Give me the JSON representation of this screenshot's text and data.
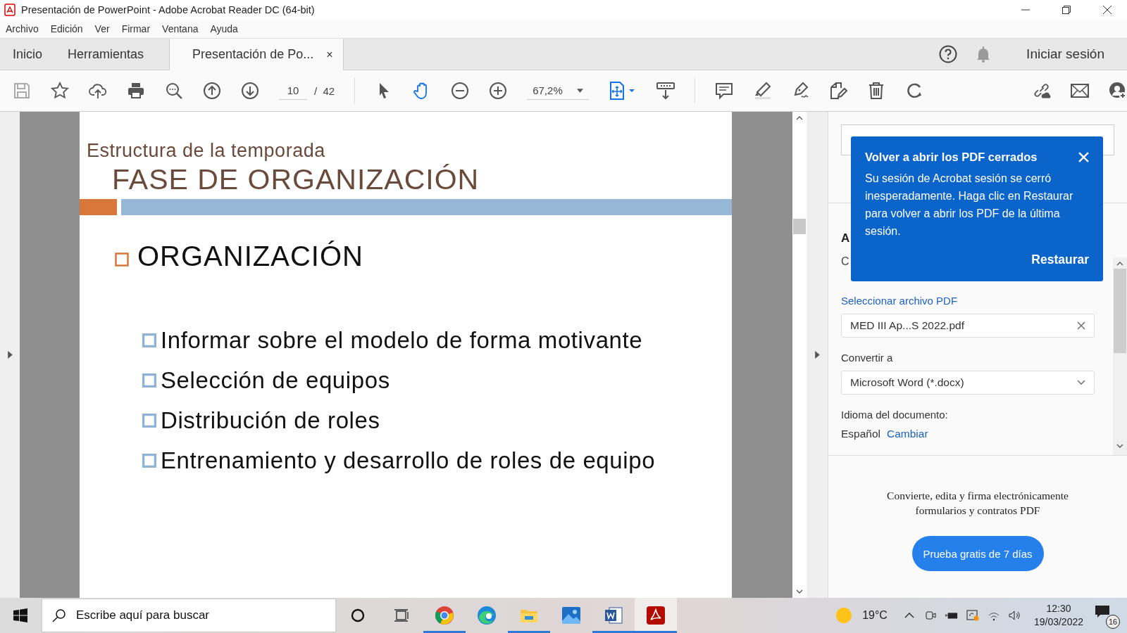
{
  "window": {
    "title": "Presentación de PowerPoint - Adobe Acrobat Reader DC (64-bit)"
  },
  "menu": [
    "Archivo",
    "Edición",
    "Ver",
    "Firmar",
    "Ventana",
    "Ayuda"
  ],
  "tabs": [
    {
      "label": "Inicio",
      "selected": false,
      "closable": false
    },
    {
      "label": "Herramientas",
      "selected": false,
      "closable": false
    },
    {
      "label": "Presentación de Po...",
      "selected": true,
      "closable": true
    }
  ],
  "close_tab": "×",
  "sign_in": "Iniciar sesión",
  "toolbar": {
    "page": "10",
    "page_total": "/  42",
    "zoom": "67,2%",
    "tools": [
      {
        "kind": "pointer",
        "selected": false
      },
      {
        "kind": "hand",
        "selected": true
      }
    ]
  },
  "slide": {
    "subtitle": "Estructura de la temporada",
    "title": "FASE DE ORGANIZACIÓN",
    "heading": "ORGANIZACIÓN",
    "bullets": [
      "Informar sobre el modelo de forma motivante",
      "Selección de equipos",
      "Distribución de roles",
      "Entrenamiento y desarrollo de roles de equipo"
    ]
  },
  "panel": {
    "cut_heading": "A",
    "cut_text": "C",
    "select_label": "Seleccionar archivo PDF",
    "file": "MED III Ap...S 2022.pdf",
    "convert_label": "Convertir a",
    "format": "Microsoft Word (*.docx)",
    "language_label": "Idioma del documento:",
    "language": "Español",
    "change_link": "Cambiar",
    "promo": "Convierte, edita y firma electrónicamente formularios y contratos PDF",
    "trial_button": "Prueba gratis de 7 días"
  },
  "popup": {
    "title": "Volver a abrir los PDF cerrados",
    "body": "Su sesión de Acrobat sesión se cerró inesperadamente. Haga clic en Restaurar para volver a abrir los PDF de la última sesión.",
    "action": "Restaurar"
  },
  "taskbar": {
    "search_placeholder": "Escribe aquí para buscar",
    "apps": [
      {
        "kind": "chrome",
        "running": true,
        "selected": false
      },
      {
        "kind": "edge",
        "running": false,
        "selected": false
      },
      {
        "kind": "explorer",
        "running": true,
        "selected": false
      },
      {
        "kind": "photos",
        "running": false,
        "selected": false
      },
      {
        "kind": "word",
        "running": true,
        "selected": false
      },
      {
        "kind": "acrobat",
        "running": true,
        "selected": true
      }
    ],
    "temperature": "19°C",
    "time": "12:30",
    "date": "19/03/2022",
    "notifications": "16"
  }
}
